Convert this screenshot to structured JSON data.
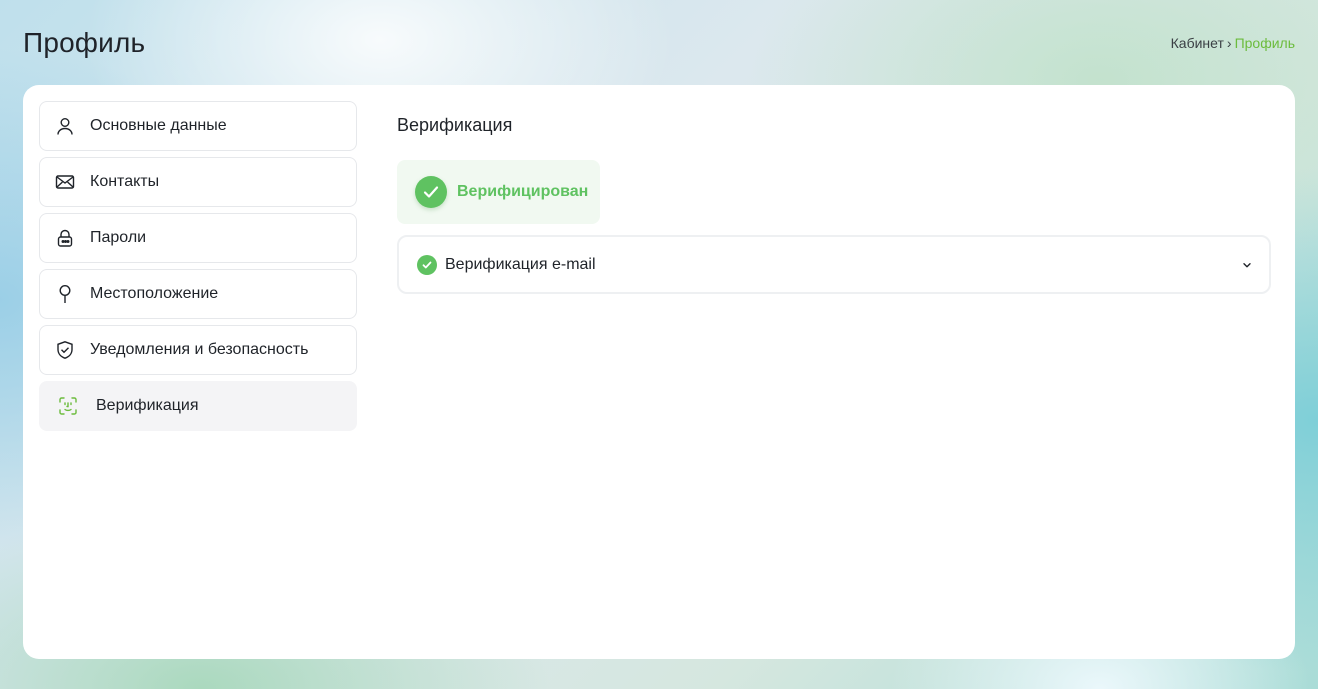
{
  "header": {
    "title": "Профиль",
    "breadcrumb": {
      "root": "Кабинет",
      "separator": "›",
      "current": "Профиль"
    }
  },
  "sidebar": {
    "items": [
      {
        "label": "Основные данные",
        "icon": "user-icon",
        "active": false
      },
      {
        "label": "Контакты",
        "icon": "envelope-icon",
        "active": false
      },
      {
        "label": "Пароли",
        "icon": "lock-icon",
        "active": false
      },
      {
        "label": "Местоположение",
        "icon": "map-pin-icon",
        "active": false
      },
      {
        "label": "Уведомления и безопасность",
        "icon": "shield-check-icon",
        "active": false
      },
      {
        "label": "Верификация",
        "icon": "face-scan-icon",
        "active": true
      }
    ]
  },
  "main": {
    "section_title": "Верификация",
    "status_badge": "Верифицирован",
    "accordion": {
      "label": "Верификация e-mail",
      "expanded": false
    }
  },
  "colors": {
    "accent_green": "#5fc261",
    "breadcrumb_active": "#6cbc3d",
    "active_item_bg": "#f4f4f6"
  }
}
